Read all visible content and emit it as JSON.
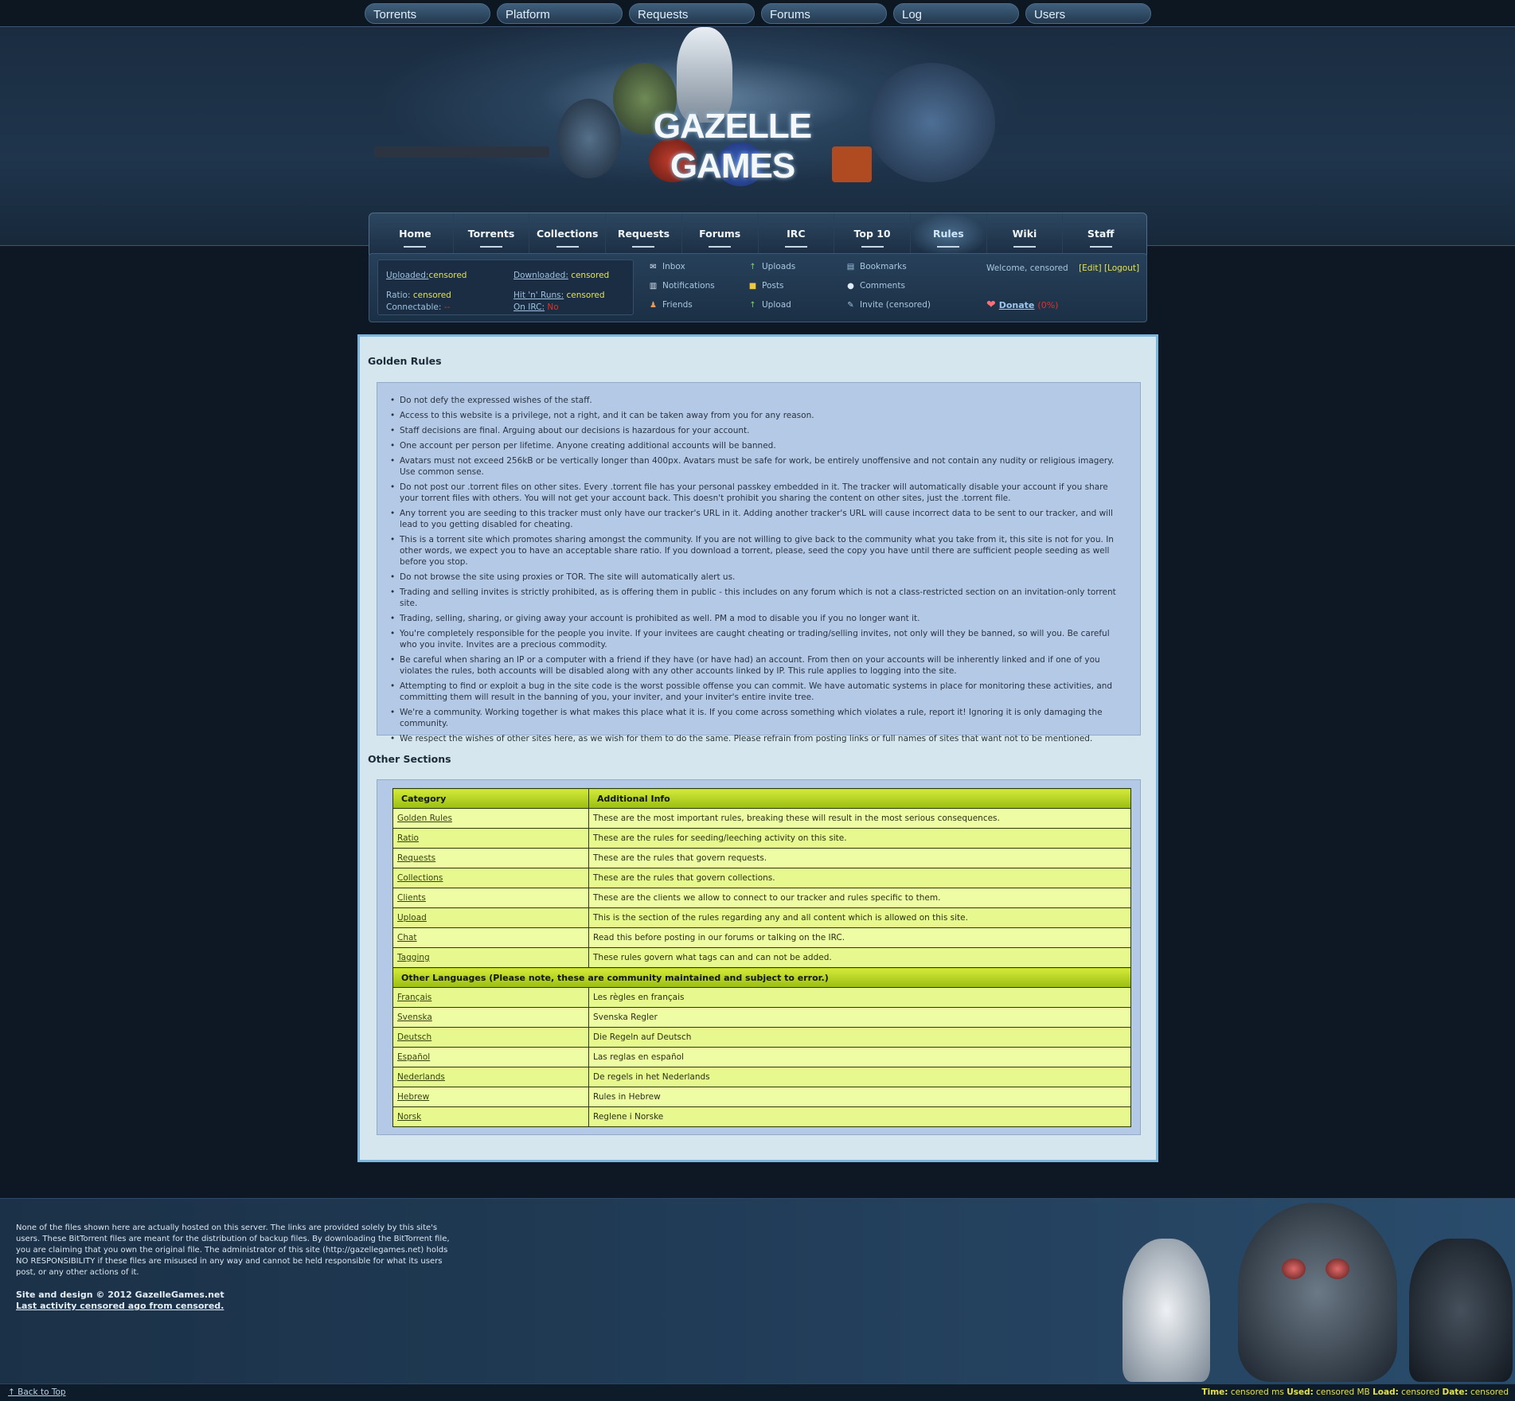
{
  "topbar": {
    "tabs": [
      "Torrents",
      "Platform",
      "Requests",
      "Forums",
      "Log",
      "Users"
    ]
  },
  "header": {
    "logo_text": "GAZELLE GAMES"
  },
  "mainnav": {
    "items": [
      "Home",
      "Torrents",
      "Collections",
      "Requests",
      "Forums",
      "IRC",
      "Top 10",
      "Rules",
      "Wiki",
      "Staff"
    ],
    "active": "Rules"
  },
  "userpanel": {
    "uploaded_label": "Uploaded:",
    "uploaded_value": "censored",
    "downloaded_label": "Downloaded:",
    "downloaded_value": "censored",
    "ratio_label": "Ratio:",
    "ratio_value": "censored",
    "hnr_label": "Hit 'n' Runs:",
    "hnr_value": "censored",
    "connectable_label": "Connectable:",
    "connectable_value": "--",
    "irc_label": "On IRC:",
    "irc_value": "No",
    "links": {
      "inbox": "Inbox",
      "notifications": "Notifications",
      "friends": "Friends",
      "uploads": "Uploads",
      "posts": "Posts",
      "upload": "Upload",
      "bookmarks": "Bookmarks",
      "comments": "Comments",
      "invite": "Invite (censored)"
    },
    "welcome": "Welcome, censored",
    "edit": "[Edit]",
    "logout": "[Logout]",
    "donate": "Donate",
    "donate_pct": "(0%)"
  },
  "content": {
    "golden_title": "Golden Rules",
    "golden_rules": [
      "Do not defy the expressed wishes of the staff.",
      "Access to this website is a privilege, not a right, and it can be taken away from you for any reason.",
      "Staff decisions are final. Arguing about our decisions is hazardous for your account.",
      "One account per person per lifetime. Anyone creating additional accounts will be banned.",
      "Avatars must not exceed 256kB or be vertically longer than 400px. Avatars must be safe for work, be entirely unoffensive and not contain any nudity or religious imagery. Use common sense.",
      "Do not post our .torrent files on other sites. Every .torrent file has your personal passkey embedded in it. The tracker will automatically disable your account if you share your torrent files with others. You will not get your account back. This doesn't prohibit you sharing the content on other sites, just the .torrent file.",
      "Any torrent you are seeding to this tracker must only have our tracker's URL in it. Adding another tracker's URL will cause incorrect data to be sent to our tracker, and will lead to you getting disabled for cheating.",
      "This is a torrent site which promotes sharing amongst the community. If you are not willing to give back to the community what you take from it, this site is not for you. In other words, we expect you to have an acceptable share ratio. If you download a torrent, please, seed the copy you have until there are sufficient people seeding as well before you stop.",
      "Do not browse the site using proxies or TOR. The site will automatically alert us.",
      "Trading and selling invites is strictly prohibited, as is offering them in public - this includes on any forum which is not a class-restricted section on an invitation-only torrent site.",
      "Trading, selling, sharing, or giving away your account is prohibited as well. PM a mod to disable you if you no longer want it.",
      "You're completely responsible for the people you invite. If your invitees are caught cheating or trading/selling invites, not only will they be banned, so will you. Be careful who you invite. Invites are a precious commodity.",
      "Be careful when sharing an IP or a computer with a friend if they have (or have had) an account. From then on your accounts will be inherently linked and if one of you violates the rules, both accounts will be disabled along with any other accounts linked by IP. This rule applies to logging into the site.",
      "Attempting to find or exploit a bug in the site code is the worst possible offense you can commit. We have automatic systems in place for monitoring these activities, and committing them will result in the banning of you, your inviter, and your inviter's entire invite tree.",
      "We're a community. Working together is what makes this place what it is. If you come across something which violates a rule, report it! Ignoring it is only damaging the community.",
      "We respect the wishes of other sites here, as we wish for them to do the same. Please refrain from posting links or full names of sites that want not to be mentioned."
    ],
    "sections_title": "Other Sections",
    "table_headers": [
      "Category",
      "Additional Info"
    ],
    "sections": [
      {
        "category": "Golden Rules",
        "info": "These are the most important rules, breaking these will result in the most serious consequences."
      },
      {
        "category": "Ratio",
        "info": "These are the rules for seeding/leeching activity on this site."
      },
      {
        "category": "Requests",
        "info": "These are the rules that govern requests."
      },
      {
        "category": "Collections",
        "info": "These are the rules that govern collections."
      },
      {
        "category": "Clients",
        "info": "These are the clients we allow to connect to our tracker and rules specific to them."
      },
      {
        "category": "Upload",
        "info": "This is the section of the rules regarding any and all content which is allowed on this site."
      },
      {
        "category": "Chat",
        "info": "Read this before posting in our forums or talking on the IRC."
      },
      {
        "category": "Tagging",
        "info": "These rules govern what tags can and can not be added."
      }
    ],
    "languages_header": "Other Languages (Please note, these are community maintained and subject to error.)",
    "languages": [
      {
        "category": "Français",
        "info": "Les règles en français"
      },
      {
        "category": "Svenska",
        "info": "Svenska Regler"
      },
      {
        "category": "Deutsch",
        "info": "Die Regeln auf Deutsch"
      },
      {
        "category": "Español",
        "info": "Las reglas en español"
      },
      {
        "category": "Nederlands",
        "info": "De regels in het Nederlands"
      },
      {
        "category": "Hebrew",
        "info": "Rules in Hebrew"
      },
      {
        "category": "Norsk",
        "info": "Reglene i Norske"
      }
    ]
  },
  "footer": {
    "disclaimer": "None of the files shown here are actually hosted on this server. The links are provided solely by this site's users. These BitTorrent files are meant for the distribution of backup files. By downloading the BitTorrent file, you are claiming that you own the original file. The administrator of this site (http://gazellegames.net) holds NO RESPONSIBILITY if these files are misused in any way and cannot be held responsible for what its users post, or any other actions of it.",
    "copyright": "Site and design © 2012 GazelleGames.net",
    "last_activity": "Last activity censored ago from censored.",
    "back_to_top": "↑ Back to Top",
    "perf_time_label": "Time:",
    "perf_time": "censored ms",
    "perf_used_label": "Used:",
    "perf_used": "censored MB",
    "perf_load_label": "Load:",
    "perf_load": "censored",
    "perf_date_label": "Date:",
    "perf_date": "censored"
  }
}
